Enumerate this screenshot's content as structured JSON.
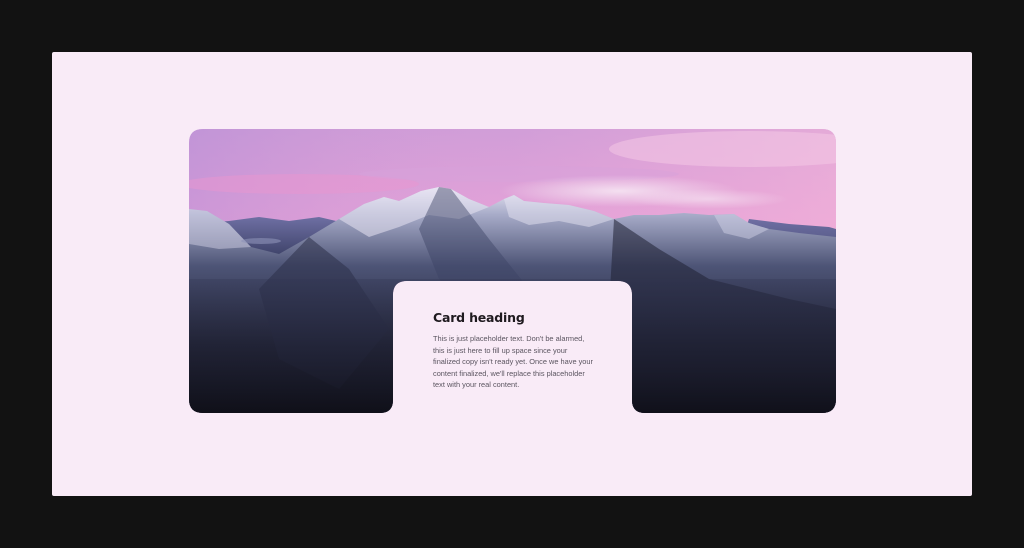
{
  "card": {
    "heading": "Card heading",
    "body": "This is just placeholder text. Don't be alarmed, this is just here to fill up space since your finalized copy isn't ready yet. Once we have your content finalized, we'll replace this placeholder text with your real content."
  },
  "colors": {
    "outer_background": "#121212",
    "frame_background": "#f9ebf7",
    "sky_top": "#d9a6d9",
    "sky_pink": "#e79ad3",
    "mountain_dark": "#1a1b2a"
  },
  "icons": []
}
